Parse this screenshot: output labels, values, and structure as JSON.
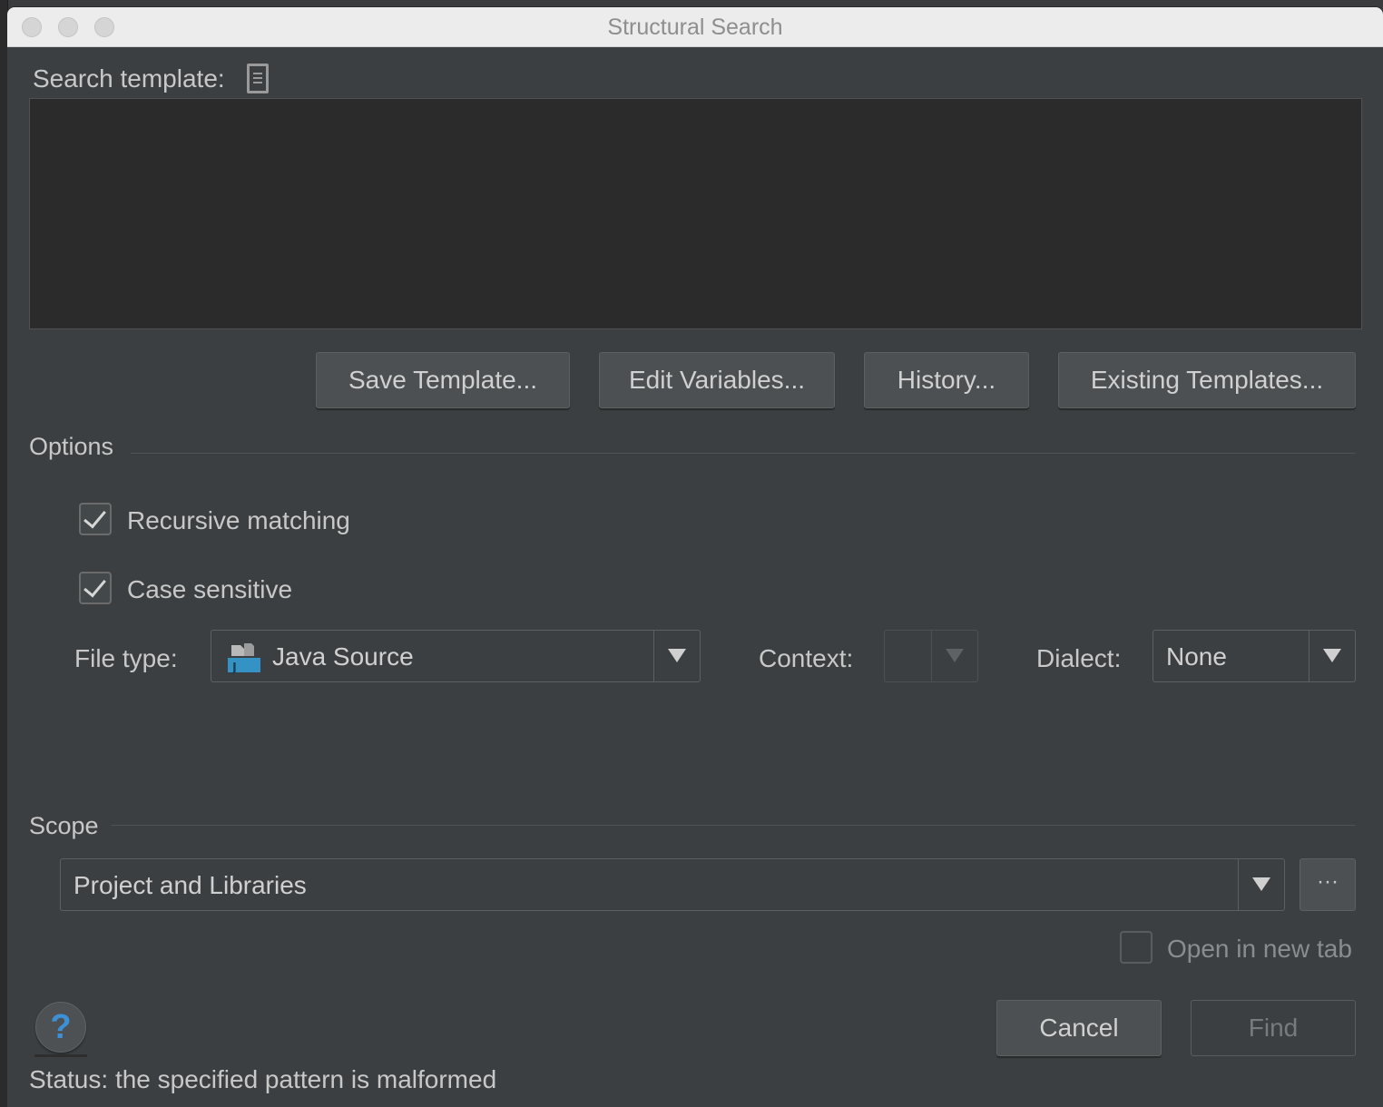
{
  "window": {
    "title": "Structural Search"
  },
  "search_template": {
    "label": "Search template:",
    "value": ""
  },
  "template_buttons": {
    "save": "Save Template...",
    "edit_variables": "Edit Variables...",
    "history": "History...",
    "existing": "Existing Templates..."
  },
  "options": {
    "heading": "Options",
    "recursive_matching": {
      "label": "Recursive matching",
      "checked": true
    },
    "case_sensitive": {
      "label": "Case sensitive",
      "checked": true
    },
    "file_type": {
      "label": "File type:",
      "value": "Java Source",
      "icon": "java-source-icon"
    },
    "context": {
      "label": "Context:",
      "value": ""
    },
    "dialect": {
      "label": "Dialect:",
      "value": "None"
    }
  },
  "scope": {
    "heading": "Scope",
    "value": "Project and Libraries",
    "more_button": "···"
  },
  "open_in_new_tab": {
    "label": "Open in new tab",
    "checked": false
  },
  "actions": {
    "cancel": "Cancel",
    "find": "Find"
  },
  "help_button": "?",
  "status": "Status: the specified pattern is malformed",
  "colors": {
    "dialog_bg": "#3c3f41",
    "editor_bg": "#2b2b2b",
    "button_bg": "#4c5052",
    "help_icon": "#3d8fd6",
    "java_icon": "#3592c4"
  }
}
